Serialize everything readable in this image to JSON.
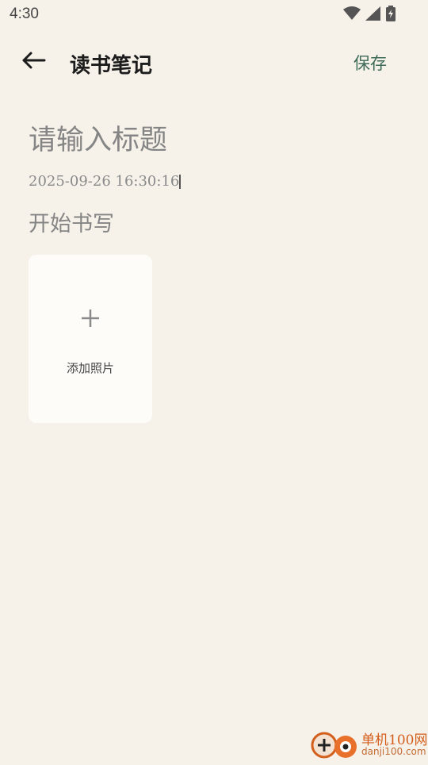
{
  "status_bar": {
    "time": "4:30",
    "icons": [
      "wifi-icon",
      "cell-signal-icon",
      "battery-charging-icon"
    ]
  },
  "app_bar": {
    "back_icon": "back-arrow-icon",
    "title": "读书笔记",
    "save_label": "保存"
  },
  "editor": {
    "title_placeholder": "请输入标题",
    "timestamp": "2025-09-26 16:30:16",
    "body_placeholder": "开始书写"
  },
  "add_photo": {
    "icon": "plus-icon",
    "label": "添加照片"
  },
  "watermark": {
    "name": "单机100网",
    "url": "danji100.com"
  },
  "colors": {
    "background": "#f6f2ea",
    "card": "#fdfcf8",
    "accent": "#3e6a58",
    "placeholder": "#858585",
    "watermark": "#d45f1c"
  }
}
